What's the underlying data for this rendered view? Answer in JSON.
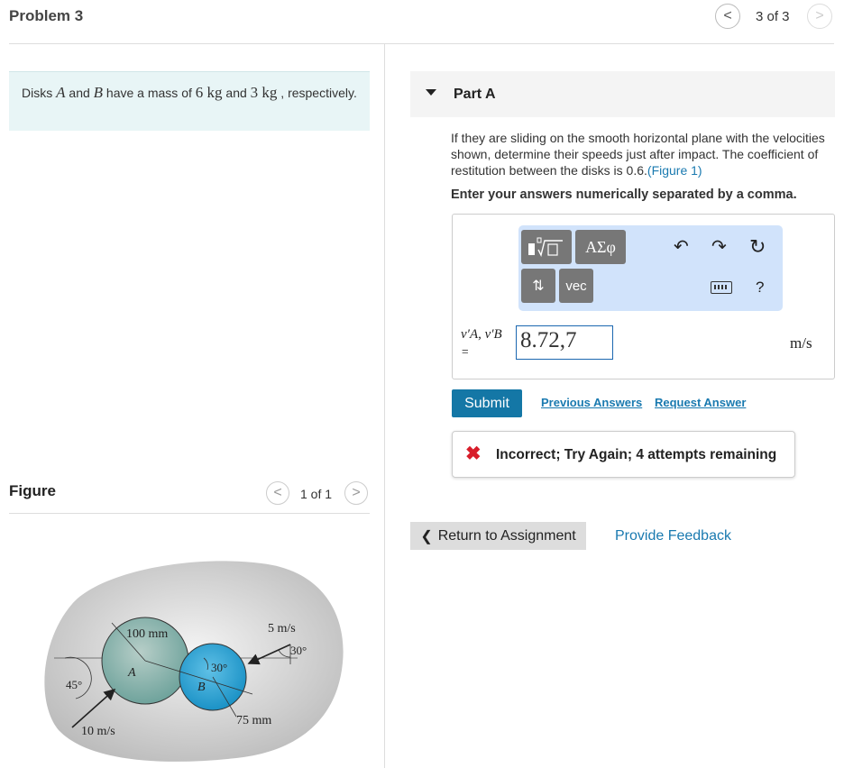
{
  "header": {
    "problem_title": "Problem 3",
    "nav_count": "3 of 3",
    "prev_glyph": "<",
    "next_glyph": ">"
  },
  "statement": {
    "prefix": "Disks ",
    "disk_a": "A",
    "and": " and ",
    "disk_b": "B",
    "mass_text": " have a mass of ",
    "mass_a": "6",
    "kg1": " kg",
    "and2": " and ",
    "mass_b": "3",
    "kg2": " kg",
    "suffix": " , respectively."
  },
  "figure": {
    "label": "Figure",
    "count": "1 of 1",
    "labels": {
      "radius_a": "100 mm",
      "speed_b": "5 m/s",
      "angle_b": "30°",
      "angle_contact": "30°",
      "angle_a": "45°",
      "disk_a": "A",
      "disk_b": "B",
      "radius_b": "75 mm",
      "speed_a": "10 m/s"
    }
  },
  "part": {
    "title": "Part A",
    "question": "If they are sliding on the smooth horizontal plane with the velocities shown, determine their speeds just after impact. The coefficient of restitution between the disks is 0.6.",
    "figure_link": "(Figure 1)",
    "instruction": "Enter your answers numerically separated by a comma."
  },
  "toolbar": {
    "template_icon": "template-icon",
    "greek_label": "ΑΣφ",
    "subsup_label": "⇅",
    "vec_label": "vec",
    "undo_glyph": "↶",
    "redo_glyph": "↷",
    "reset_glyph": "↻",
    "help_label": "?"
  },
  "answer": {
    "label_a": "v′A, v′B",
    "eq": "=",
    "value": "8.72,7",
    "unit": "m/s"
  },
  "actions": {
    "submit": "Submit",
    "previous_answers": "Previous Answers",
    "request_answer": "Request Answer"
  },
  "feedback": {
    "icon": "✖",
    "text": "Incorrect; Try Again; 4 attempts remaining"
  },
  "footer": {
    "return_glyph": "❮",
    "return_label": "Return to Assignment",
    "provide_feedback": "Provide Feedback"
  }
}
